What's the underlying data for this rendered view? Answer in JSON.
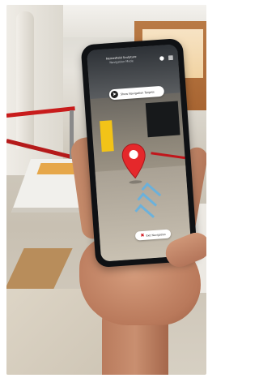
{
  "app": {
    "header_title": "Nemesfield Sculpture",
    "header_subtitle": "Navigation Mode"
  },
  "navigation_button": {
    "label": "Show Navigation Targets",
    "icon": "navigation-icon"
  },
  "exit_button": {
    "label": "Exit Navigation",
    "icon": "close-icon"
  },
  "header_icons": [
    "info-icon",
    "qr-scan-icon"
  ],
  "colors": {
    "pin": "#e5282b",
    "arrow": "#5fb2e6",
    "rope": "#c81c1c"
  }
}
